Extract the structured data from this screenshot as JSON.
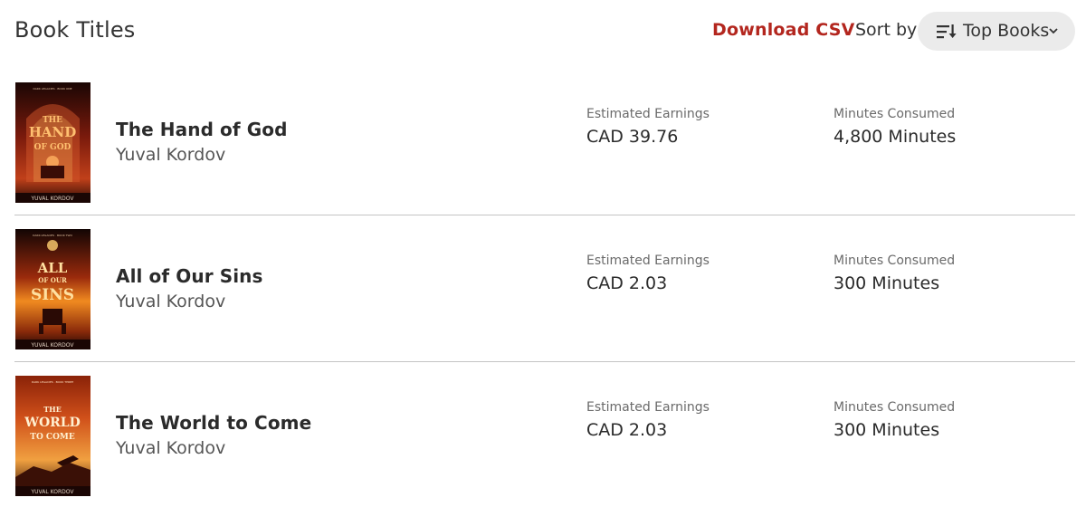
{
  "header": {
    "title": "Book Titles",
    "download_label": "Download CSV",
    "sort_label": "Sort by",
    "sort_value": "Top Books"
  },
  "books": [
    {
      "title": "The Hand of God",
      "author": "Yuval Kordov",
      "earnings_label": "Estimated Earnings",
      "earnings": "CAD 39.76",
      "minutes_label": "Minutes Consumed",
      "minutes": "4,800 Minutes",
      "cover": {
        "series": "DARK LEGACIES · BOOK ONE",
        "lines": [
          "THE",
          "HAND",
          "OF GOD"
        ],
        "author": "YUVAL KORDOV"
      }
    },
    {
      "title": "All of Our Sins",
      "author": "Yuval Kordov",
      "earnings_label": "Estimated Earnings",
      "earnings": "CAD 2.03",
      "minutes_label": "Minutes Consumed",
      "minutes": "300 Minutes",
      "cover": {
        "series": "DARK LEGACIES · BOOK TWO",
        "lines": [
          "ALL",
          "OF OUR",
          "SINS"
        ],
        "author": "YUVAL KORDOV"
      }
    },
    {
      "title": "The World to Come",
      "author": "Yuval Kordov",
      "earnings_label": "Estimated Earnings",
      "earnings": "CAD 2.03",
      "minutes_label": "Minutes Consumed",
      "minutes": "300 Minutes",
      "cover": {
        "series": "DARK LEGACIES · BOOK THREE",
        "lines": [
          "THE",
          "WORLD",
          "TO COME"
        ],
        "author": "YUVAL KORDOV"
      }
    }
  ],
  "colors": {
    "accent": "#b3261e",
    "divider": "#c4c4c4",
    "sort_bg": "#ebebeb"
  }
}
